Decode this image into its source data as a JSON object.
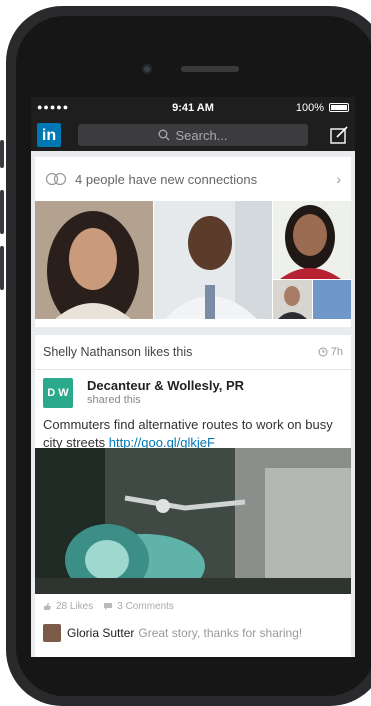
{
  "status_bar": {
    "signal": "●●●●● ",
    "time": "9:41 AM",
    "battery": "100%"
  },
  "nav": {
    "logo": "in",
    "search_placeholder": "Search..."
  },
  "connections": {
    "text": "4 people have new connections"
  },
  "post": {
    "activity": "Shelly Nathanson likes this",
    "time": "7h",
    "author_initials": "D W",
    "author_name": "Decanteur & Wollesly, PR",
    "author_sub": "shared this",
    "text": "Commuters find alternative routes to work on busy city streets ",
    "link": "http://goo.gl/glkjeF",
    "likes": "28 Likes",
    "comments": "3 Comments",
    "commenter": "Gloria Sutter",
    "comment_text": "Great story, thanks for sharing!"
  },
  "colors": {
    "brand": "#0077b5",
    "author_badge": "#2aa98c",
    "dark_bar": "#1e1e1f"
  }
}
